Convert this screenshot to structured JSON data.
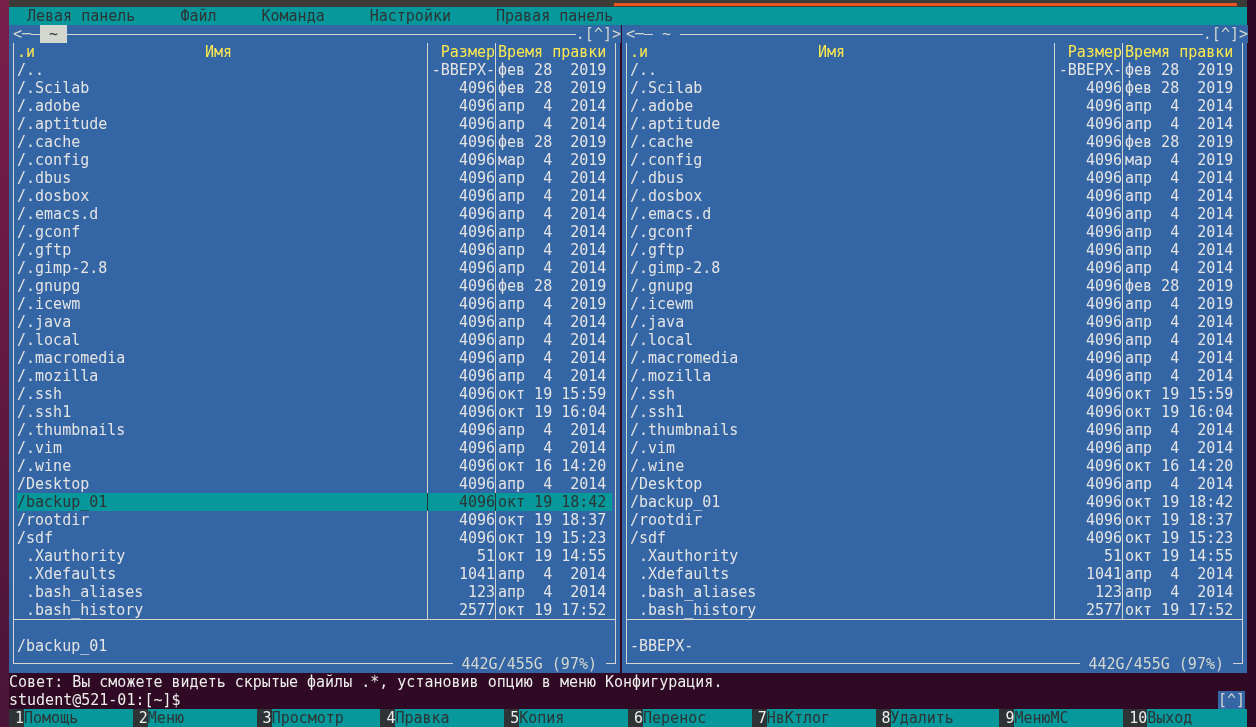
{
  "menu": [
    {
      "label": "Левая панель"
    },
    {
      "label": "Файл"
    },
    {
      "label": "Команда"
    },
    {
      "label": "Настройки"
    },
    {
      "label": "Правая панель"
    }
  ],
  "panels": [
    {
      "active": true,
      "path": "~",
      "history": "<─",
      "up_button": ".[^]>",
      "columns": [
        ".и",
        "Имя",
        "Размер",
        "Время правки"
      ],
      "info": "/backup_01",
      "free": "442G/455G (97%)",
      "rows": [
        {
          "name": "/..",
          "kind": "dir",
          "size": "-ВВЕРХ-",
          "date": "фев 28  2019",
          "selected": false
        },
        {
          "name": "/.Scilab",
          "kind": "dir",
          "size": "4096",
          "date": "фев 28  2019",
          "selected": false
        },
        {
          "name": "/.adobe",
          "kind": "dir",
          "size": "4096",
          "date": "апр  4  2014",
          "selected": false
        },
        {
          "name": "/.aptitude",
          "kind": "dir",
          "size": "4096",
          "date": "апр  4  2014",
          "selected": false
        },
        {
          "name": "/.cache",
          "kind": "dir",
          "size": "4096",
          "date": "фев 28  2019",
          "selected": false
        },
        {
          "name": "/.config",
          "kind": "dir",
          "size": "4096",
          "date": "мар  4  2019",
          "selected": false
        },
        {
          "name": "/.dbus",
          "kind": "dir",
          "size": "4096",
          "date": "апр  4  2014",
          "selected": false
        },
        {
          "name": "/.dosbox",
          "kind": "dir",
          "size": "4096",
          "date": "апр  4  2014",
          "selected": false
        },
        {
          "name": "/.emacs.d",
          "kind": "dir",
          "size": "4096",
          "date": "апр  4  2014",
          "selected": false
        },
        {
          "name": "/.gconf",
          "kind": "dir",
          "size": "4096",
          "date": "апр  4  2014",
          "selected": false
        },
        {
          "name": "/.gftp",
          "kind": "dir",
          "size": "4096",
          "date": "апр  4  2014",
          "selected": false
        },
        {
          "name": "/.gimp-2.8",
          "kind": "dir",
          "size": "4096",
          "date": "апр  4  2014",
          "selected": false
        },
        {
          "name": "/.gnupg",
          "kind": "dir",
          "size": "4096",
          "date": "фев 28  2019",
          "selected": false
        },
        {
          "name": "/.icewm",
          "kind": "dir",
          "size": "4096",
          "date": "апр  4  2019",
          "selected": false
        },
        {
          "name": "/.java",
          "kind": "dir",
          "size": "4096",
          "date": "апр  4  2014",
          "selected": false
        },
        {
          "name": "/.local",
          "kind": "dir",
          "size": "4096",
          "date": "апр  4  2014",
          "selected": false
        },
        {
          "name": "/.macromedia",
          "kind": "dir",
          "size": "4096",
          "date": "апр  4  2014",
          "selected": false
        },
        {
          "name": "/.mozilla",
          "kind": "dir",
          "size": "4096",
          "date": "апр  4  2014",
          "selected": false
        },
        {
          "name": "/.ssh",
          "kind": "dir",
          "size": "4096",
          "date": "окт 19 15:59",
          "selected": false
        },
        {
          "name": "/.ssh1",
          "kind": "dir",
          "size": "4096",
          "date": "окт 19 16:04",
          "selected": false
        },
        {
          "name": "/.thumbnails",
          "kind": "dir",
          "size": "4096",
          "date": "апр  4  2014",
          "selected": false
        },
        {
          "name": "/.vim",
          "kind": "dir",
          "size": "4096",
          "date": "апр  4  2014",
          "selected": false
        },
        {
          "name": "/.wine",
          "kind": "dir",
          "size": "4096",
          "date": "окт 16 14:20",
          "selected": false
        },
        {
          "name": "/Desktop",
          "kind": "dir",
          "size": "4096",
          "date": "апр  4  2014",
          "selected": false
        },
        {
          "name": "/backup_01",
          "kind": "dir",
          "size": "4096",
          "date": "окт 19 18:42",
          "selected": true
        },
        {
          "name": "/rootdir",
          "kind": "dir",
          "size": "4096",
          "date": "окт 19 18:37",
          "selected": false
        },
        {
          "name": "/sdf",
          "kind": "dir",
          "size": "4096",
          "date": "окт 19 15:23",
          "selected": false
        },
        {
          "name": ".Xauthority",
          "kind": "file",
          "size": "51",
          "date": "окт 19 14:55",
          "selected": false
        },
        {
          "name": ".Xdefaults",
          "kind": "file",
          "size": "1041",
          "date": "апр  4  2014",
          "selected": false
        },
        {
          "name": ".bash_aliases",
          "kind": "file",
          "size": "123",
          "date": "апр  4  2014",
          "selected": false
        },
        {
          "name": ".bash_history",
          "kind": "file",
          "size": "2577",
          "date": "окт 19 17:52",
          "selected": false
        }
      ]
    },
    {
      "active": false,
      "path": "~",
      "history": "<─",
      "up_button": ".[^]>",
      "columns": [
        ".и",
        "Имя",
        "Размер",
        "Время правки"
      ],
      "info": "-ВВЕРХ-",
      "free": "442G/455G (97%)",
      "rows": [
        {
          "name": "/..",
          "kind": "dir",
          "size": "-ВВЕРХ-",
          "date": "фев 28  2019",
          "selected": false
        },
        {
          "name": "/.Scilab",
          "kind": "dir",
          "size": "4096",
          "date": "фев 28  2019",
          "selected": false
        },
        {
          "name": "/.adobe",
          "kind": "dir",
          "size": "4096",
          "date": "апр  4  2014",
          "selected": false
        },
        {
          "name": "/.aptitude",
          "kind": "dir",
          "size": "4096",
          "date": "апр  4  2014",
          "selected": false
        },
        {
          "name": "/.cache",
          "kind": "dir",
          "size": "4096",
          "date": "фев 28  2019",
          "selected": false
        },
        {
          "name": "/.config",
          "kind": "dir",
          "size": "4096",
          "date": "мар  4  2019",
          "selected": false
        },
        {
          "name": "/.dbus",
          "kind": "dir",
          "size": "4096",
          "date": "апр  4  2014",
          "selected": false
        },
        {
          "name": "/.dosbox",
          "kind": "dir",
          "size": "4096",
          "date": "апр  4  2014",
          "selected": false
        },
        {
          "name": "/.emacs.d",
          "kind": "dir",
          "size": "4096",
          "date": "апр  4  2014",
          "selected": false
        },
        {
          "name": "/.gconf",
          "kind": "dir",
          "size": "4096",
          "date": "апр  4  2014",
          "selected": false
        },
        {
          "name": "/.gftp",
          "kind": "dir",
          "size": "4096",
          "date": "апр  4  2014",
          "selected": false
        },
        {
          "name": "/.gimp-2.8",
          "kind": "dir",
          "size": "4096",
          "date": "апр  4  2014",
          "selected": false
        },
        {
          "name": "/.gnupg",
          "kind": "dir",
          "size": "4096",
          "date": "фев 28  2019",
          "selected": false
        },
        {
          "name": "/.icewm",
          "kind": "dir",
          "size": "4096",
          "date": "апр  4  2019",
          "selected": false
        },
        {
          "name": "/.java",
          "kind": "dir",
          "size": "4096",
          "date": "апр  4  2014",
          "selected": false
        },
        {
          "name": "/.local",
          "kind": "dir",
          "size": "4096",
          "date": "апр  4  2014",
          "selected": false
        },
        {
          "name": "/.macromedia",
          "kind": "dir",
          "size": "4096",
          "date": "апр  4  2014",
          "selected": false
        },
        {
          "name": "/.mozilla",
          "kind": "dir",
          "size": "4096",
          "date": "апр  4  2014",
          "selected": false
        },
        {
          "name": "/.ssh",
          "kind": "dir",
          "size": "4096",
          "date": "окт 19 15:59",
          "selected": false
        },
        {
          "name": "/.ssh1",
          "kind": "dir",
          "size": "4096",
          "date": "окт 19 16:04",
          "selected": false
        },
        {
          "name": "/.thumbnails",
          "kind": "dir",
          "size": "4096",
          "date": "апр  4  2014",
          "selected": false
        },
        {
          "name": "/.vim",
          "kind": "dir",
          "size": "4096",
          "date": "апр  4  2014",
          "selected": false
        },
        {
          "name": "/.wine",
          "kind": "dir",
          "size": "4096",
          "date": "окт 16 14:20",
          "selected": false
        },
        {
          "name": "/Desktop",
          "kind": "dir",
          "size": "4096",
          "date": "апр  4  2014",
          "selected": false
        },
        {
          "name": "/backup_01",
          "kind": "dir",
          "size": "4096",
          "date": "окт 19 18:42",
          "selected": false
        },
        {
          "name": "/rootdir",
          "kind": "dir",
          "size": "4096",
          "date": "окт 19 18:37",
          "selected": false
        },
        {
          "name": "/sdf",
          "kind": "dir",
          "size": "4096",
          "date": "окт 19 15:23",
          "selected": false
        },
        {
          "name": ".Xauthority",
          "kind": "file",
          "size": "51",
          "date": "окт 19 14:55",
          "selected": false
        },
        {
          "name": ".Xdefaults",
          "kind": "file",
          "size": "1041",
          "date": "апр  4  2014",
          "selected": false
        },
        {
          "name": ".bash_aliases",
          "kind": "file",
          "size": "123",
          "date": "апр  4  2014",
          "selected": false
        },
        {
          "name": ".bash_history",
          "kind": "file",
          "size": "2577",
          "date": "окт 19 17:52",
          "selected": false
        }
      ]
    }
  ],
  "hint": "Совет: Вы сможете видеть скрытые файлы .*, установив опцию в меню Конфигурация.",
  "prompt": "student@521-01:[~]$",
  "corner_button": "[^]",
  "function_keys": [
    {
      "num": "1",
      "label": "Помощь"
    },
    {
      "num": "2",
      "label": "Меню"
    },
    {
      "num": "3",
      "label": "Просмотр"
    },
    {
      "num": "4",
      "label": "Правка"
    },
    {
      "num": "5",
      "label": "Копия"
    },
    {
      "num": "6",
      "label": "Перенос"
    },
    {
      "num": "7",
      "label": "НвКтлог"
    },
    {
      "num": "8",
      "label": "Удалить"
    },
    {
      "num": "9",
      "label": "МенюМС"
    },
    {
      "num": "10",
      "label": "Выход"
    }
  ]
}
